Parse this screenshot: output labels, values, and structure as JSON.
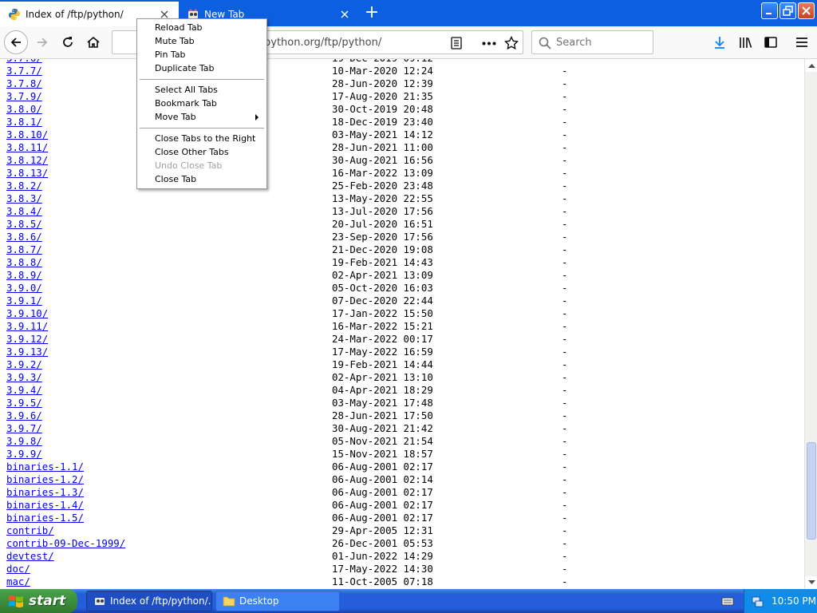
{
  "tabs": [
    {
      "title": "Index of /ftp/python/",
      "active": true
    },
    {
      "title": "New Tab",
      "active": false
    }
  ],
  "toolbar": {
    "url": "python.org/ftp/python/",
    "search_placeholder": "Search"
  },
  "context_menu": {
    "items": [
      {
        "label": "Reload Tab",
        "enabled": true
      },
      {
        "label": "Mute Tab",
        "enabled": true
      },
      {
        "label": "Pin Tab",
        "enabled": true
      },
      {
        "label": "Duplicate Tab",
        "enabled": true
      },
      {
        "label": "Select All Tabs",
        "enabled": true
      },
      {
        "label": "Bookmark Tab",
        "enabled": true
      },
      {
        "label": "Move Tab",
        "enabled": true,
        "has_submenu": true
      },
      {
        "label": "Close Tabs to the Right",
        "enabled": true
      },
      {
        "label": "Close Other Tabs",
        "enabled": true
      },
      {
        "label": "Undo Close Tab",
        "enabled": false
      },
      {
        "label": "Close Tab",
        "enabled": true
      }
    ]
  },
  "listing": [
    {
      "name": "3.7.7/",
      "date": "10-Mar-2020 12:24",
      "size": "-"
    },
    {
      "name": "3.7.8/",
      "date": "28-Jun-2020 12:39",
      "size": "-"
    },
    {
      "name": "3.7.9/",
      "date": "17-Aug-2020 21:35",
      "size": "-"
    },
    {
      "name": "3.8.0/",
      "date": "30-Oct-2019 20:48",
      "size": "-"
    },
    {
      "name": "3.8.1/",
      "date": "18-Dec-2019 23:40",
      "size": "-"
    },
    {
      "name": "3.8.10/",
      "date": "03-May-2021 14:12",
      "size": "-"
    },
    {
      "name": "3.8.11/",
      "date": "28-Jun-2021 11:00",
      "size": "-"
    },
    {
      "name": "3.8.12/",
      "date": "30-Aug-2021 16:56",
      "size": "-"
    },
    {
      "name": "3.8.13/",
      "date": "16-Mar-2022 13:09",
      "size": "-"
    },
    {
      "name": "3.8.2/",
      "date": "25-Feb-2020 23:48",
      "size": "-"
    },
    {
      "name": "3.8.3/",
      "date": "13-May-2020 22:55",
      "size": "-"
    },
    {
      "name": "3.8.4/",
      "date": "13-Jul-2020 17:56",
      "size": "-"
    },
    {
      "name": "3.8.5/",
      "date": "20-Jul-2020 16:51",
      "size": "-"
    },
    {
      "name": "3.8.6/",
      "date": "23-Sep-2020 17:56",
      "size": "-"
    },
    {
      "name": "3.8.7/",
      "date": "21-Dec-2020 19:08",
      "size": "-"
    },
    {
      "name": "3.8.8/",
      "date": "19-Feb-2021 14:43",
      "size": "-"
    },
    {
      "name": "3.8.9/",
      "date": "02-Apr-2021 13:09",
      "size": "-"
    },
    {
      "name": "3.9.0/",
      "date": "05-Oct-2020 16:03",
      "size": "-"
    },
    {
      "name": "3.9.1/",
      "date": "07-Dec-2020 22:44",
      "size": "-"
    },
    {
      "name": "3.9.10/",
      "date": "17-Jan-2022 15:50",
      "size": "-"
    },
    {
      "name": "3.9.11/",
      "date": "16-Mar-2022 15:21",
      "size": "-"
    },
    {
      "name": "3.9.12/",
      "date": "24-Mar-2022 00:17",
      "size": "-"
    },
    {
      "name": "3.9.13/",
      "date": "17-May-2022 16:59",
      "size": "-"
    },
    {
      "name": "3.9.2/",
      "date": "19-Feb-2021 14:44",
      "size": "-"
    },
    {
      "name": "3.9.3/",
      "date": "02-Apr-2021 13:10",
      "size": "-"
    },
    {
      "name": "3.9.4/",
      "date": "04-Apr-2021 18:29",
      "size": "-"
    },
    {
      "name": "3.9.5/",
      "date": "03-May-2021 17:48",
      "size": "-"
    },
    {
      "name": "3.9.6/",
      "date": "28-Jun-2021 17:50",
      "size": "-"
    },
    {
      "name": "3.9.7/",
      "date": "30-Aug-2021 21:42",
      "size": "-"
    },
    {
      "name": "3.9.8/",
      "date": "05-Nov-2021 21:54",
      "size": "-"
    },
    {
      "name": "3.9.9/",
      "date": "15-Nov-2021 18:57",
      "size": "-"
    },
    {
      "name": "binaries-1.1/",
      "date": "06-Aug-2001 02:17",
      "size": "-"
    },
    {
      "name": "binaries-1.2/",
      "date": "06-Aug-2001 02:14",
      "size": "-"
    },
    {
      "name": "binaries-1.3/",
      "date": "06-Aug-2001 02:17",
      "size": "-"
    },
    {
      "name": "binaries-1.4/",
      "date": "06-Aug-2001 02:17",
      "size": "-"
    },
    {
      "name": "binaries-1.5/",
      "date": "06-Aug-2001 02:17",
      "size": "-"
    },
    {
      "name": "contrib/",
      "date": "29-Apr-2005 12:31",
      "size": "-"
    },
    {
      "name": "contrib-09-Dec-1999/",
      "date": "26-Dec-2001 05:53",
      "size": "-"
    },
    {
      "name": "devtest/",
      "date": "01-Jun-2022 14:29",
      "size": "-"
    },
    {
      "name": "doc/",
      "date": "17-May-2022 14:30",
      "size": "-"
    },
    {
      "name": "mac/",
      "date": "11-Oct-2005 07:18",
      "size": "-"
    }
  ],
  "taskbar": {
    "start_label": "start",
    "tasks": [
      {
        "label": "Index of /ftp/python/..."
      },
      {
        "label": "Desktop"
      }
    ],
    "clock": "10:50 PM"
  },
  "colors": {
    "link": "#0000ee",
    "titlebar": "#0b5fe0",
    "taskbar": "#245edb",
    "start_green": "#3c8f3c"
  }
}
